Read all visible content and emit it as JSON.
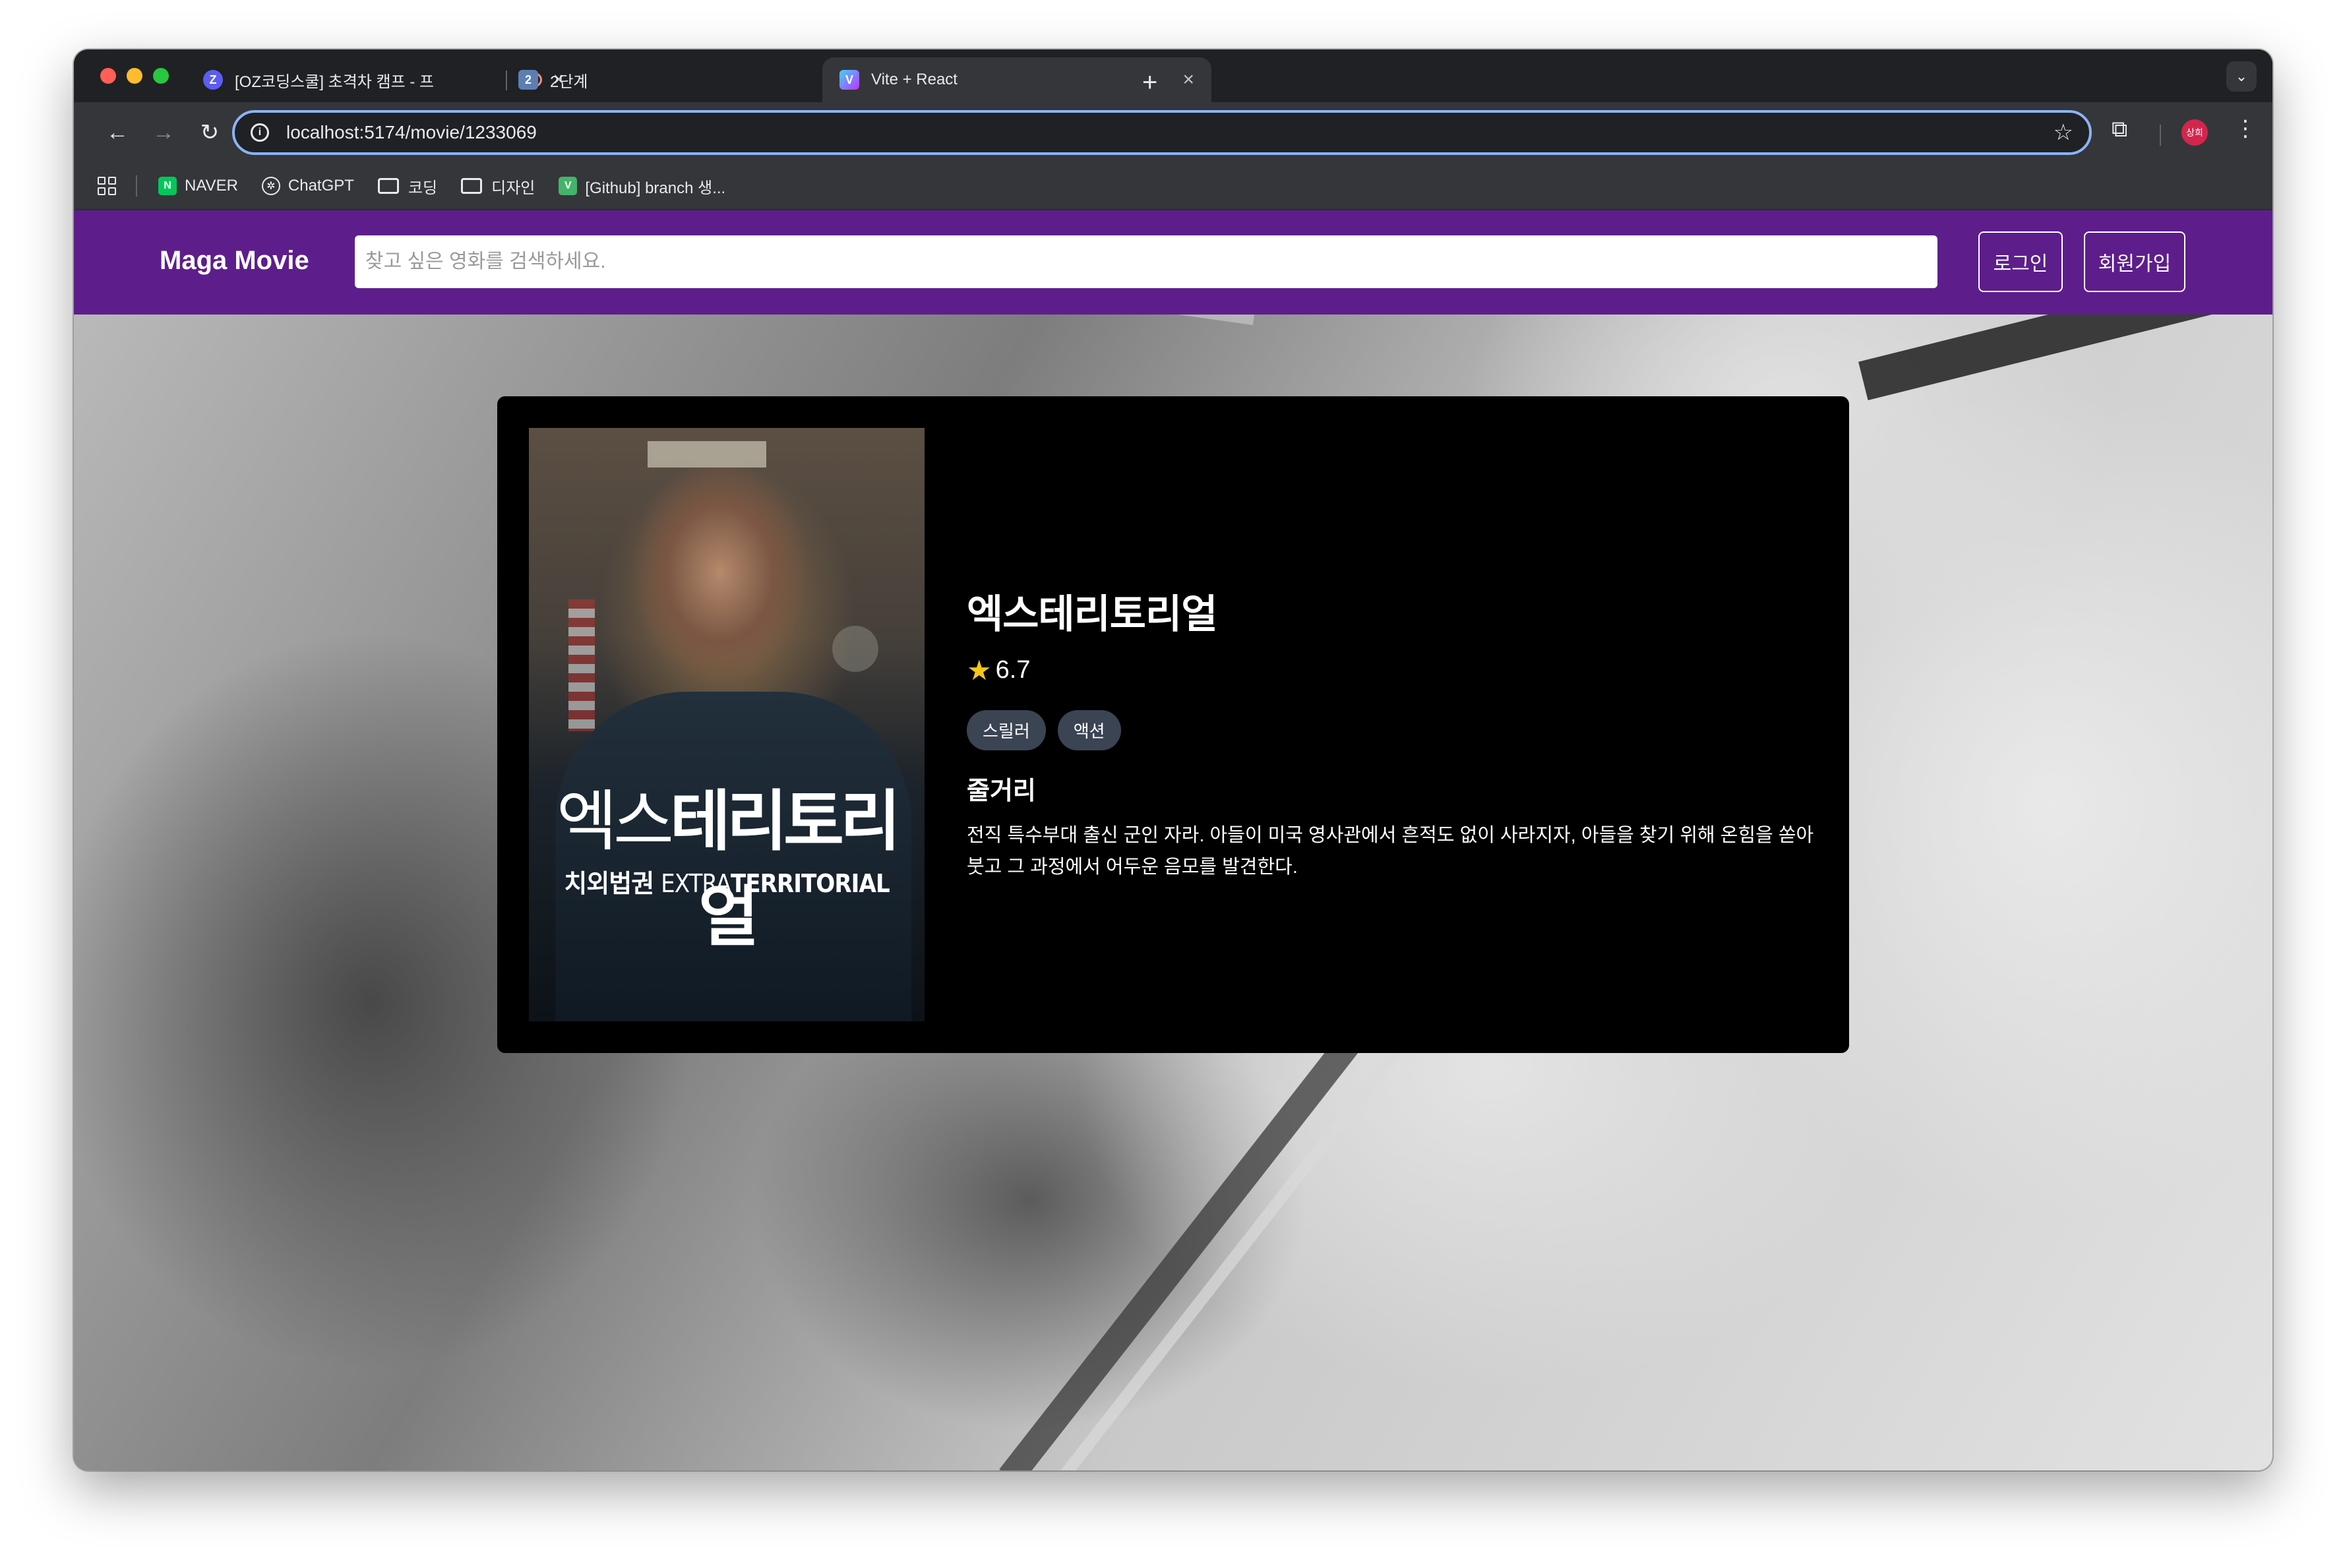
{
  "browser": {
    "tabs": [
      {
        "title": "[OZ코딩스쿨] 초격차 캠프 - 프",
        "favicon": "Z",
        "favicon_color": "#5b5ef0"
      },
      {
        "title": "2단계",
        "favicon": "2",
        "favicon_color": "#5c7fb3"
      },
      {
        "title": "Vite + React",
        "favicon": "V",
        "favicon_color": "#8a5cf6"
      }
    ],
    "url": "localhost:5174/movie/1233069",
    "profile_label": "상희",
    "bookmarks": [
      {
        "label": "NAVER",
        "icon": "N",
        "icon_color": "#03c75a"
      },
      {
        "label": "ChatGPT",
        "icon": "chatgpt-icon"
      },
      {
        "label": "코딩",
        "icon": "folder-icon"
      },
      {
        "label": "디자인",
        "icon": "folder-icon"
      },
      {
        "label": "[Github] branch 생...",
        "icon": "V",
        "icon_color": "#45b36b"
      }
    ]
  },
  "app": {
    "logo": "Maga Movie",
    "search_placeholder": "찾고 싶은 영화를 검색하세요.",
    "login_label": "로그인",
    "signup_label": "회원가입",
    "header_color": "#5d1e8c"
  },
  "movie": {
    "title": "엑스테리토리얼",
    "rating": "6.7",
    "genres": [
      "스릴러",
      "액션"
    ],
    "synopsis_heading": "줄거리",
    "synopsis": "전직 특수부대 출신 군인 자라. 아들이 미국 영사관에서 흔적도 없이 사라지자, 아들을 찾기 위해 온힘을 쏟아붓고 그 과정에서 어두운 음모를 발견한다.",
    "poster": {
      "title_part1": "엑스",
      "title_part2": "테리토리얼",
      "subtitle_kr": "치외법권",
      "subtitle_en_light": "EXTRA",
      "subtitle_en_bold": "TERRITORIAL"
    }
  }
}
